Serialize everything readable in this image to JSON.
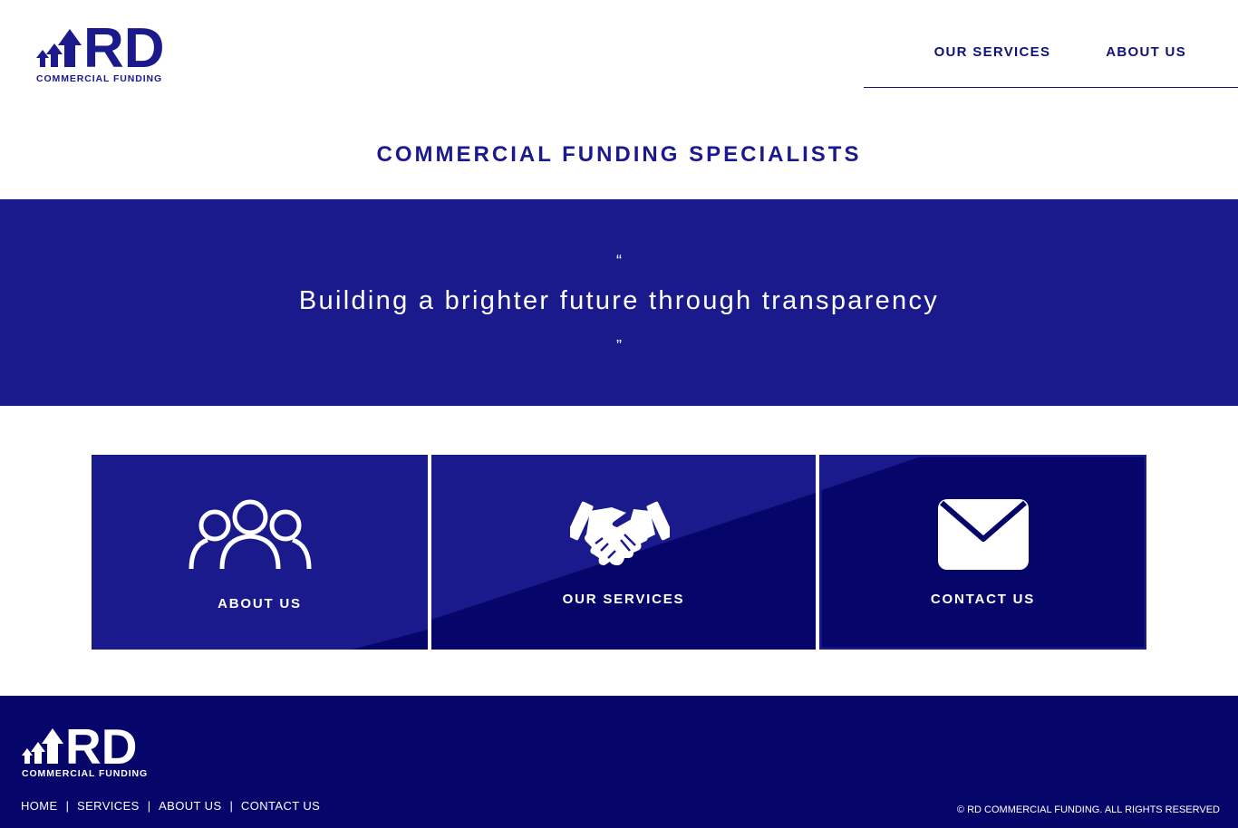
{
  "colors": {
    "brand_blue": "#1a1a8c",
    "dark_navy": "#06066a",
    "white": "#ffffff"
  },
  "header": {
    "logo": {
      "mark_text": "RD",
      "sub_text": "COMMERCIAL FUNDING",
      "icon": "house-arrows-icon"
    },
    "nav": [
      {
        "label": "OUR SERVICES"
      },
      {
        "label": "ABOUT US"
      }
    ]
  },
  "tagline": "COMMERCIAL FUNDING SPECIALISTS",
  "quote": {
    "open_mark": "“",
    "text": "Building a brighter future through transparency",
    "close_mark": "”"
  },
  "tiles": [
    {
      "label": "ABOUT US",
      "icon": "people-group-icon"
    },
    {
      "label": "OUR SERVICES",
      "icon": "handshake-icon"
    },
    {
      "label": "CONTACT US",
      "icon": "envelope-icon"
    }
  ],
  "footer": {
    "logo": {
      "mark_text": "RD",
      "sub_text": "COMMERCIAL FUNDING"
    },
    "links": [
      {
        "label": "HOME"
      },
      {
        "label": "SERVICES"
      },
      {
        "label": "ABOUT US"
      },
      {
        "label": "CONTACT US"
      }
    ],
    "separator": "|",
    "copyright": "© RD COMMERCIAL FUNDING. ALL RIGHTS RESERVED"
  }
}
